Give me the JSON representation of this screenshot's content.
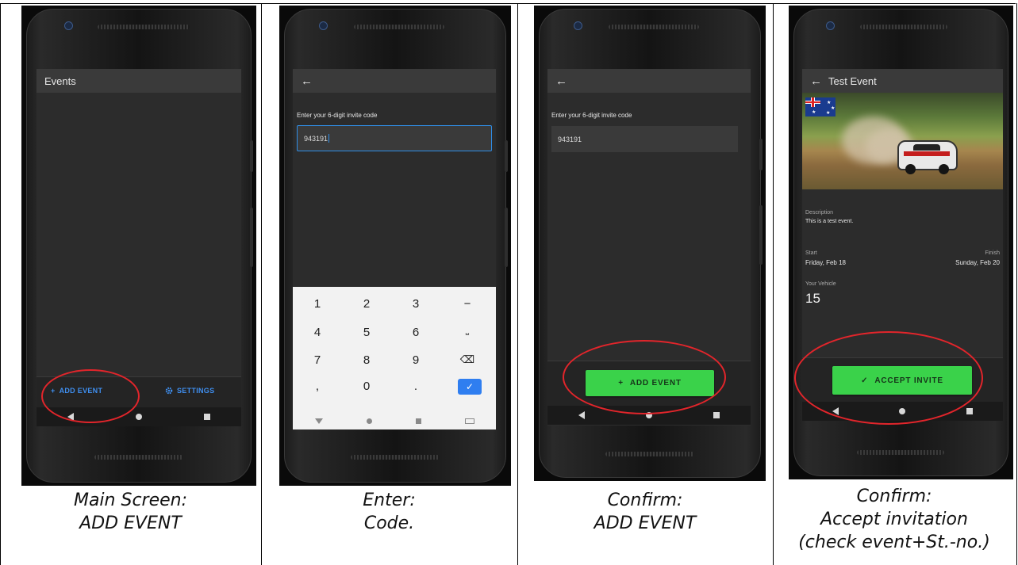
{
  "panels": [
    {
      "title": "Events",
      "bottom_actions": {
        "add_label": "ADD EVENT",
        "settings_label": "SETTINGS"
      },
      "caption": [
        "Main Screen:",
        "ADD EVENT"
      ]
    },
    {
      "prompt": "Enter your 6-digit invite code",
      "code_value": "943191",
      "keypad": [
        "1",
        "2",
        "3",
        "−",
        "4",
        "5",
        "6",
        "⎵",
        "7",
        "8",
        "9",
        "⌫",
        ",",
        "0",
        ".",
        "✓"
      ],
      "caption": [
        "Enter:",
        "Code."
      ]
    },
    {
      "prompt": "Enter your 6-digit invite code",
      "code_value": "943191",
      "add_button_label": "ADD EVENT",
      "caption": [
        "Confirm:",
        "ADD EVENT"
      ]
    },
    {
      "title": "Test Event",
      "description_label": "Description",
      "description_value": "This is a test event.",
      "start_label": "Start",
      "start_value": "Friday, Feb 18",
      "finish_label": "Finish",
      "finish_value": "Sunday, Feb 20",
      "vehicle_label": "Your Vehicle",
      "vehicle_value": "15",
      "accept_button_label": "ACCEPT INVITE",
      "caption": [
        "Confirm:",
        "Accept invitation",
        "(check event+St.-no.)"
      ]
    }
  ],
  "icons": {
    "back": "arrow-left-icon",
    "plus": "plus-icon",
    "gear": "gear-icon",
    "check": "checkmark-icon"
  },
  "colors": {
    "accent_blue": "#3f8ff0",
    "button_green": "#3ad24a",
    "highlight_red": "#e2252b"
  }
}
